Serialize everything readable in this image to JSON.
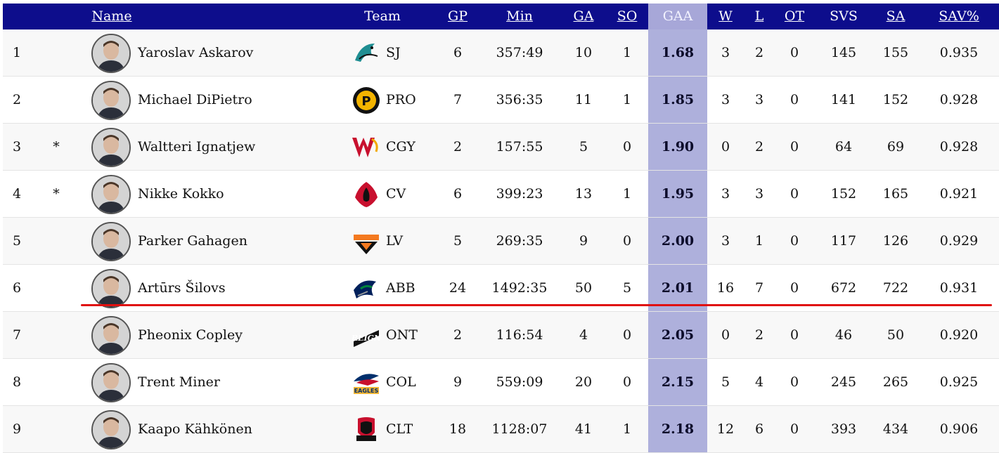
{
  "columns": {
    "name": "Name",
    "team": "Team",
    "gp": "GP",
    "min": "Min",
    "ga": "GA",
    "so": "SO",
    "gaa": "GAA",
    "w": "W",
    "l": "L",
    "ot": "OT",
    "svs": "SVS",
    "sa": "SA",
    "sav": "SAV%"
  },
  "colors": {
    "header_bg": "#0d0d8c",
    "gaa_highlight": "#aeb0dc",
    "divider": "#e01010"
  },
  "rows": [
    {
      "rank": "1",
      "mark": "",
      "name": "Yaroslav Askarov",
      "team": "SJ",
      "logo": "sj-barracuda-logo",
      "gp": "6",
      "min": "357:49",
      "ga": "10",
      "so": "1",
      "gaa": "1.68",
      "w": "3",
      "l": "2",
      "ot": "0",
      "svs": "145",
      "sa": "155",
      "sav": "0.935"
    },
    {
      "rank": "2",
      "mark": "",
      "name": "Michael DiPietro",
      "team": "PRO",
      "logo": "providence-bruins-logo",
      "gp": "7",
      "min": "356:35",
      "ga": "11",
      "so": "1",
      "gaa": "1.85",
      "w": "3",
      "l": "3",
      "ot": "0",
      "svs": "141",
      "sa": "152",
      "sav": "0.928"
    },
    {
      "rank": "3",
      "mark": "*",
      "name": "Waltteri Ignatjew",
      "team": "CGY",
      "logo": "calgary-wranglers-logo",
      "gp": "2",
      "min": "157:55",
      "ga": "5",
      "so": "0",
      "gaa": "1.90",
      "w": "0",
      "l": "2",
      "ot": "0",
      "svs": "64",
      "sa": "69",
      "sav": "0.928"
    },
    {
      "rank": "4",
      "mark": "*",
      "name": "Nikke Kokko",
      "team": "CV",
      "logo": "coachella-firebirds-logo",
      "gp": "6",
      "min": "399:23",
      "ga": "13",
      "so": "1",
      "gaa": "1.95",
      "w": "3",
      "l": "3",
      "ot": "0",
      "svs": "152",
      "sa": "165",
      "sav": "0.921"
    },
    {
      "rank": "5",
      "mark": "",
      "name": "Parker Gahagen",
      "team": "LV",
      "logo": "lehigh-valley-phantoms-logo",
      "gp": "5",
      "min": "269:35",
      "ga": "9",
      "so": "0",
      "gaa": "2.00",
      "w": "3",
      "l": "1",
      "ot": "0",
      "svs": "117",
      "sa": "126",
      "sav": "0.929"
    },
    {
      "rank": "6",
      "mark": "",
      "name": "Artūrs Šilovs",
      "team": "ABB",
      "logo": "abbotsford-canucks-logo",
      "gp": "24",
      "min": "1492:35",
      "ga": "50",
      "so": "5",
      "gaa": "2.01",
      "w": "16",
      "l": "7",
      "ot": "0",
      "svs": "672",
      "sa": "722",
      "sav": "0.931"
    },
    {
      "rank": "7",
      "mark": "",
      "name": "Pheonix Copley",
      "team": "ONT",
      "logo": "ontario-reign-logo",
      "gp": "2",
      "min": "116:54",
      "ga": "4",
      "so": "0",
      "gaa": "2.05",
      "w": "0",
      "l": "2",
      "ot": "0",
      "svs": "46",
      "sa": "50",
      "sav": "0.920"
    },
    {
      "rank": "8",
      "mark": "",
      "name": "Trent Miner",
      "team": "COL",
      "logo": "colorado-eagles-logo",
      "gp": "9",
      "min": "559:09",
      "ga": "20",
      "so": "0",
      "gaa": "2.15",
      "w": "5",
      "l": "4",
      "ot": "0",
      "svs": "245",
      "sa": "265",
      "sav": "0.925"
    },
    {
      "rank": "9",
      "mark": "",
      "name": "Kaapo Kähkönen",
      "team": "CLT",
      "logo": "charlotte-checkers-logo",
      "gp": "18",
      "min": "1128:07",
      "ga": "41",
      "so": "1",
      "gaa": "2.18",
      "w": "12",
      "l": "6",
      "ot": "0",
      "svs": "393",
      "sa": "434",
      "sav": "0.906"
    }
  ]
}
